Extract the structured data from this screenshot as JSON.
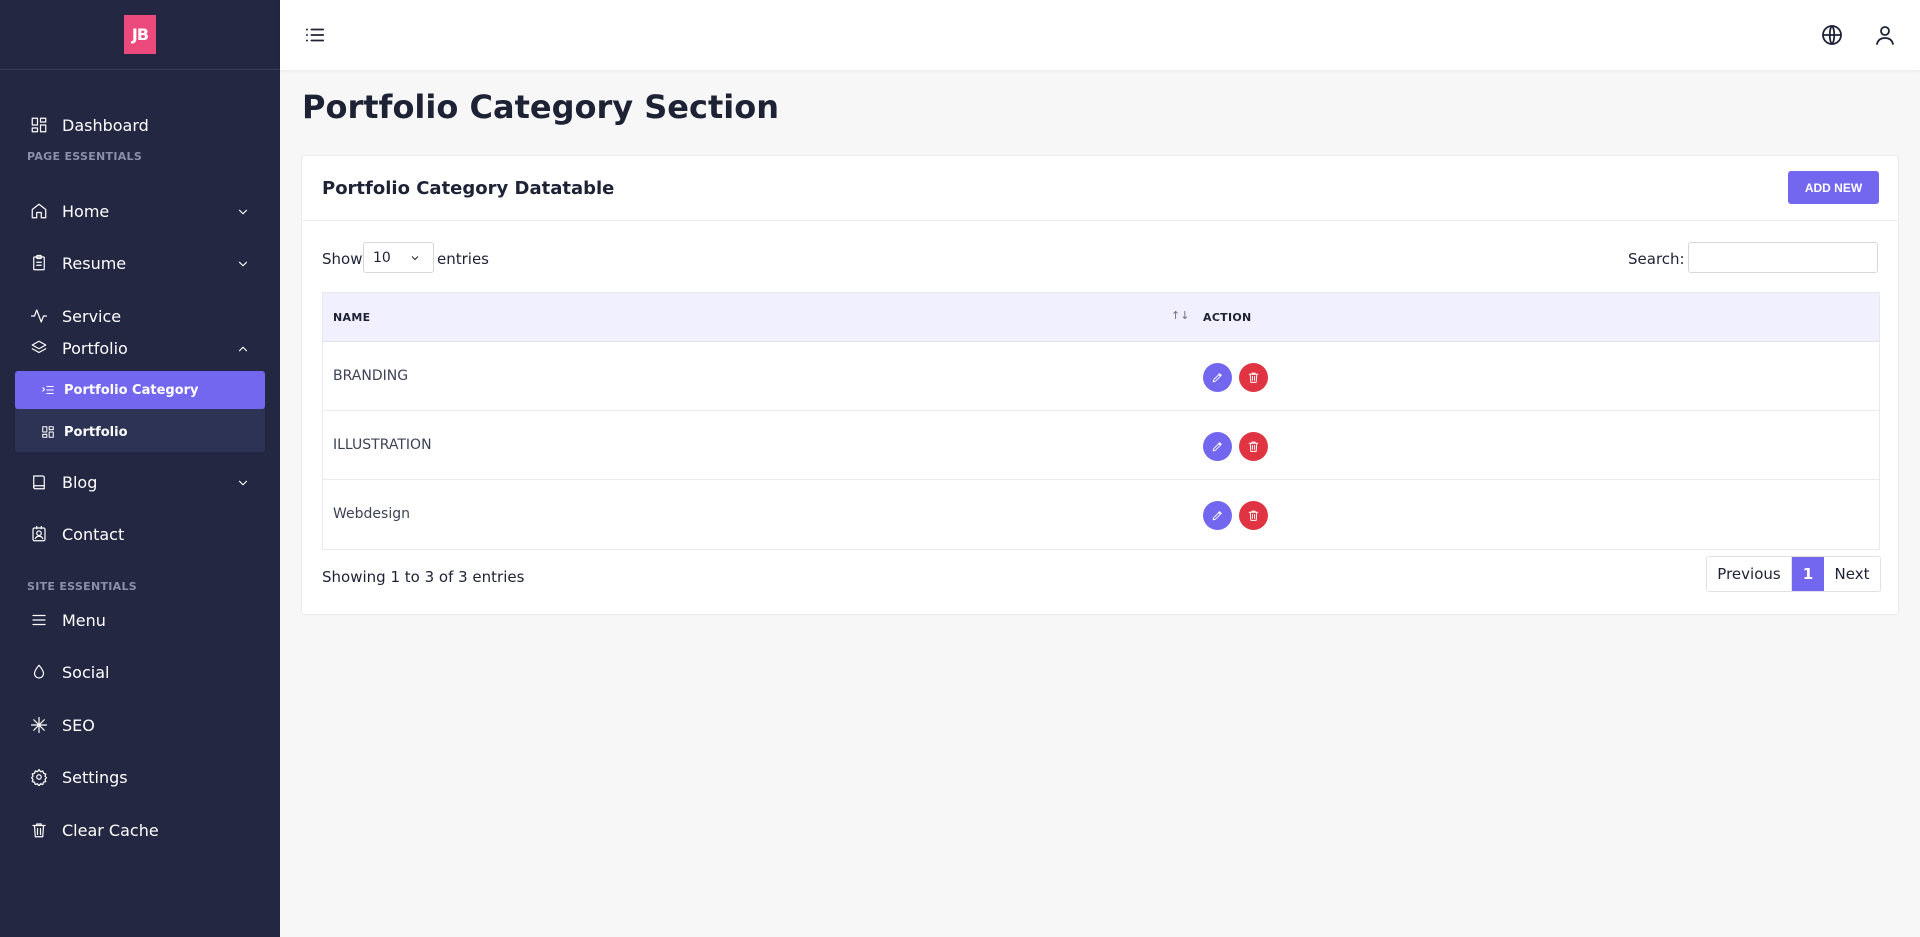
{
  "brand": {
    "logo_text": "JB",
    "logo_color": "#ec4a7d"
  },
  "sidebar": {
    "items": [
      {
        "label": "Dashboard",
        "icon": "grid-icon"
      },
      {
        "label": "Home",
        "icon": "home-icon",
        "expandable": true
      },
      {
        "label": "Resume",
        "icon": "clipboard-icon",
        "expandable": true
      },
      {
        "label": "Service",
        "icon": "activity-icon"
      },
      {
        "label": "Portfolio",
        "icon": "layers-icon",
        "expanded": true
      },
      {
        "label": "Blog",
        "icon": "book-icon",
        "expandable": true
      },
      {
        "label": "Contact",
        "icon": "contact-icon"
      },
      {
        "label": "Menu",
        "icon": "menu-icon"
      },
      {
        "label": "Social",
        "icon": "droplet-icon"
      },
      {
        "label": "SEO",
        "icon": "snowflake-icon"
      },
      {
        "label": "Settings",
        "icon": "gear-icon"
      },
      {
        "label": "Clear Cache",
        "icon": "trash-icon"
      }
    ],
    "headings": {
      "page": "PAGE ESSENTIALS",
      "site": "SITE ESSENTIALS"
    },
    "submenu": [
      {
        "label": "Portfolio Category",
        "icon": "list-icon",
        "active": true
      },
      {
        "label": "Portfolio",
        "icon": "grid-icon"
      }
    ]
  },
  "main": {
    "title": "Portfolio Category Section",
    "card": {
      "title": "Portfolio Category Datatable",
      "add_label": "ADD NEW",
      "show_label": "Show",
      "entries_value": "10",
      "entries_label": "entries",
      "search_label": "Search:",
      "search_value": ""
    },
    "table": {
      "columns": [
        "NAME",
        "ACTION"
      ],
      "sort_indicator": "↑↓",
      "rows": [
        {
          "name": "BRANDING"
        },
        {
          "name": "ILLUSTRATION"
        },
        {
          "name": "Webdesign"
        }
      ]
    },
    "info": "Showing 1 to 3 of 3 entries",
    "pagination": {
      "previous": "Previous",
      "current": "1",
      "next": "Next"
    }
  },
  "colors": {
    "accent": "#7367f0",
    "danger": "#e03442",
    "sidebar": "#232742"
  }
}
